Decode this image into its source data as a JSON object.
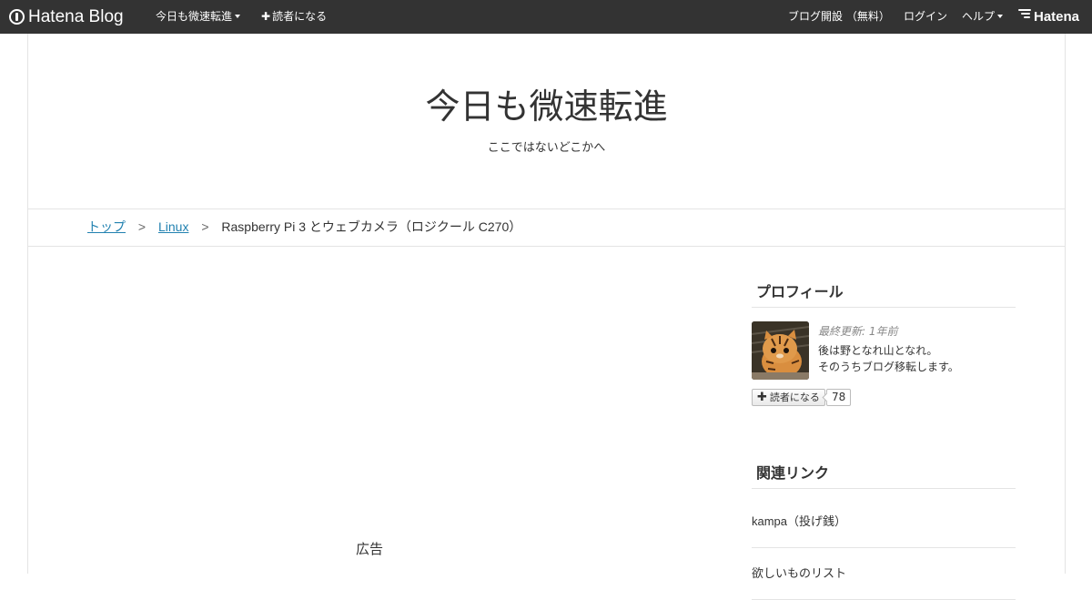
{
  "globalheader": {
    "logo_text": "Hatena Blog",
    "blog_menu_label": "今日も微速転進",
    "subscribe_label": "読者になる",
    "create_blog_label": "ブログ開設 （無料）",
    "login_label": "ログイン",
    "help_label": "ヘルプ",
    "hatena_label": "Hatena",
    "colors": {
      "bar_background": "#333333",
      "link": "#2181b0"
    }
  },
  "blog": {
    "title": "今日も微速転進",
    "description": "ここではないどこかへ"
  },
  "breadcrumb": {
    "items": [
      {
        "label": "トップ"
      },
      {
        "label": "Linux"
      }
    ],
    "separator": ">",
    "current": "Raspberry Pi 3 とウェブカメラ（ロジクール C270）"
  },
  "main": {
    "ad_label": "広告"
  },
  "sidebar": {
    "profile": {
      "title": "プロフィール",
      "updated": "最終更新: 1年前",
      "text_line1": "後は野となれ山となれ。",
      "text_line2": "そのうちブログ移転します。",
      "subscribe_label": "読者になる",
      "subscriber_count": "78",
      "icon": "tiger-avatar-icon"
    },
    "links": {
      "title": "関連リンク",
      "items": [
        {
          "label": "kampa（投げ銭）"
        },
        {
          "label": "欲しいものリスト"
        }
      ]
    }
  }
}
